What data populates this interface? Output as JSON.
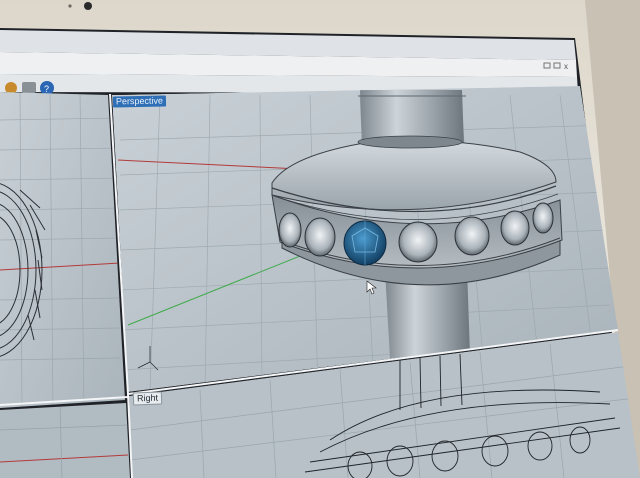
{
  "viewports": {
    "perspective": {
      "label": "Perspective"
    },
    "right": {
      "label": "Right"
    }
  },
  "toolbar": {
    "icons": [
      "camera-icon",
      "printer-icon",
      "help-icon"
    ]
  },
  "colors": {
    "screen_bezel": "#efeae1",
    "viewport_background": "#b9c2c9",
    "grid_line": "#9ba5ad",
    "x_axis": "#b23a3a",
    "y_axis": "#3faa4a",
    "active_label": "#2f6fb6",
    "gemstone": "#1f6a97"
  }
}
